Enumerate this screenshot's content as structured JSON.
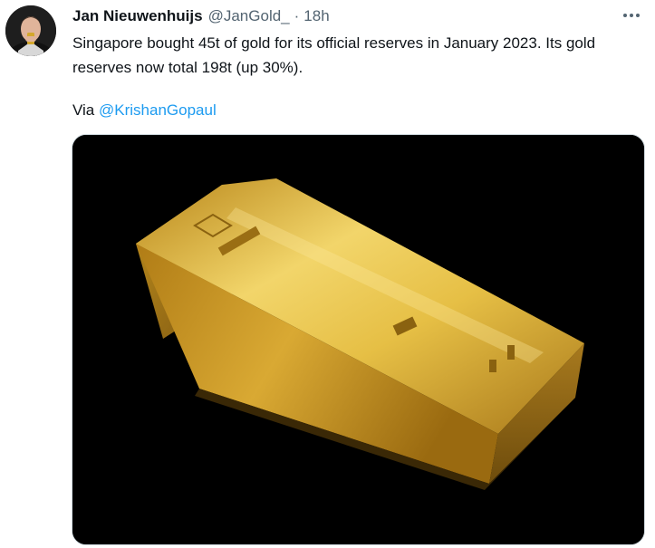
{
  "tweet": {
    "author_name": "Jan Nieuwenhuijs",
    "author_handle": "@JanGold_",
    "separator": "·",
    "timestamp": "18h",
    "text": "Singapore bought 45t of gold for its official reserves in January 2023. Its gold reserves now total 198t (up 30%).",
    "via_prefix": "Via",
    "via_mention": "@KrishanGopaul"
  },
  "icons": {
    "more": "more-options-icon"
  },
  "colors": {
    "name": "#0f1419",
    "secondary": "#536471",
    "link": "#1d9bf0",
    "gold": "#d4a82c"
  }
}
